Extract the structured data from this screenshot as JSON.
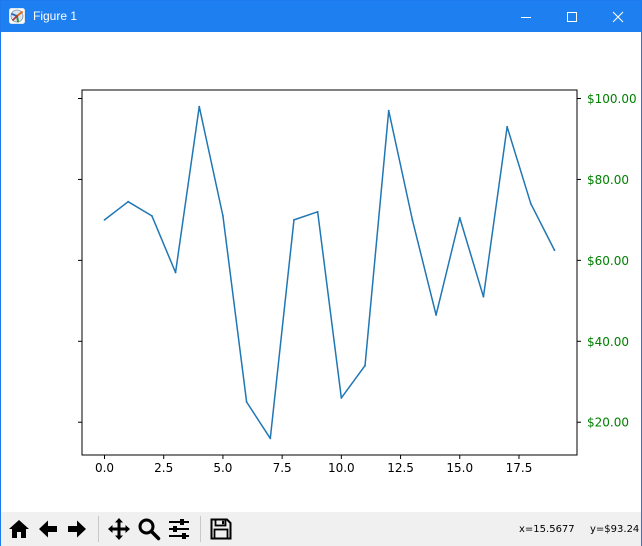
{
  "window": {
    "title": "Figure 1",
    "titlebar_color": "#1e7ff0"
  },
  "icons": {
    "app": "matplotlib-figure-icon",
    "minimize": "minimize-icon",
    "maximize": "maximize-icon",
    "close": "close-icon"
  },
  "toolbar": {
    "buttons": [
      {
        "name": "home",
        "icon": "home-icon"
      },
      {
        "name": "back",
        "icon": "arrow-left-icon"
      },
      {
        "name": "forward",
        "icon": "arrow-right-icon"
      },
      {
        "name": "pan",
        "icon": "move-icon"
      },
      {
        "name": "zoom",
        "icon": "magnifier-icon"
      },
      {
        "name": "configure-subplots",
        "icon": "sliders-icon"
      },
      {
        "name": "save",
        "icon": "floppy-disk-icon"
      }
    ],
    "status_x": "x=15.5677",
    "status_y": "y=$93.24"
  },
  "chart_data": {
    "type": "line",
    "title": "",
    "xlabel": "",
    "ylabel": "",
    "x": [
      0,
      1,
      2,
      3,
      4,
      5,
      6,
      7,
      8,
      9,
      10,
      11,
      12,
      13,
      14,
      15,
      16,
      17,
      18,
      19
    ],
    "series": [
      {
        "values": [
          70,
          74.5,
          71,
          57,
          98,
          71,
          25,
          16,
          70,
          72,
          26,
          34,
          97,
          70,
          46.5,
          70.5,
          51,
          93,
          74,
          62.5
        ],
        "color": "#1f77b4"
      }
    ],
    "xlim": [
      -0.95,
      19.95
    ],
    "ylim": [
      11.9,
      102.1
    ],
    "x_ticks": [
      {
        "value": 0,
        "label": "0.0"
      },
      {
        "value": 2.5,
        "label": "2.5"
      },
      {
        "value": 5,
        "label": "5.0"
      },
      {
        "value": 7.5,
        "label": "7.5"
      },
      {
        "value": 10,
        "label": "10.0"
      },
      {
        "value": 12.5,
        "label": "12.5"
      },
      {
        "value": 15,
        "label": "15.0"
      },
      {
        "value": 17.5,
        "label": "17.5"
      }
    ],
    "y_ticks_left": [
      20,
      40,
      60,
      80,
      100
    ],
    "y_ticks_right": [
      {
        "value": 20,
        "label": "$20.00"
      },
      {
        "value": 40,
        "label": "$40.00"
      },
      {
        "value": 60,
        "label": "$60.00"
      },
      {
        "value": 80,
        "label": "$80.00"
      },
      {
        "value": 100,
        "label": "$100.00"
      }
    ],
    "right_axis_color": "#008000",
    "grid": false,
    "legend": "none"
  }
}
